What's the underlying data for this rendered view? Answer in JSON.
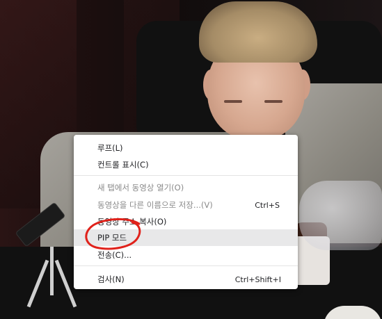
{
  "video": {
    "scene": "person-eating"
  },
  "context_menu": {
    "items": [
      {
        "label": "루프(L)",
        "shortcut": "",
        "enabled": true
      },
      {
        "label": "컨트롤 표시(C)",
        "shortcut": "",
        "enabled": true
      },
      {
        "label": "새 탭에서 동영상 열기(O)",
        "shortcut": "",
        "enabled": false
      },
      {
        "label": "동영상을 다른 이름으로 저장...(V)",
        "shortcut": "Ctrl+S",
        "enabled": false
      },
      {
        "label": "동영상 주소 복사(O)",
        "shortcut": "",
        "enabled": true
      },
      {
        "label": "PIP 모드",
        "shortcut": "",
        "enabled": true,
        "highlighted": true
      },
      {
        "label": "전송(C)...",
        "shortcut": "",
        "enabled": true
      },
      {
        "label": "검사(N)",
        "shortcut": "Ctrl+Shift+I",
        "enabled": true
      }
    ]
  },
  "annotation": {
    "color": "#e0221b",
    "target": "PIP 모드"
  }
}
